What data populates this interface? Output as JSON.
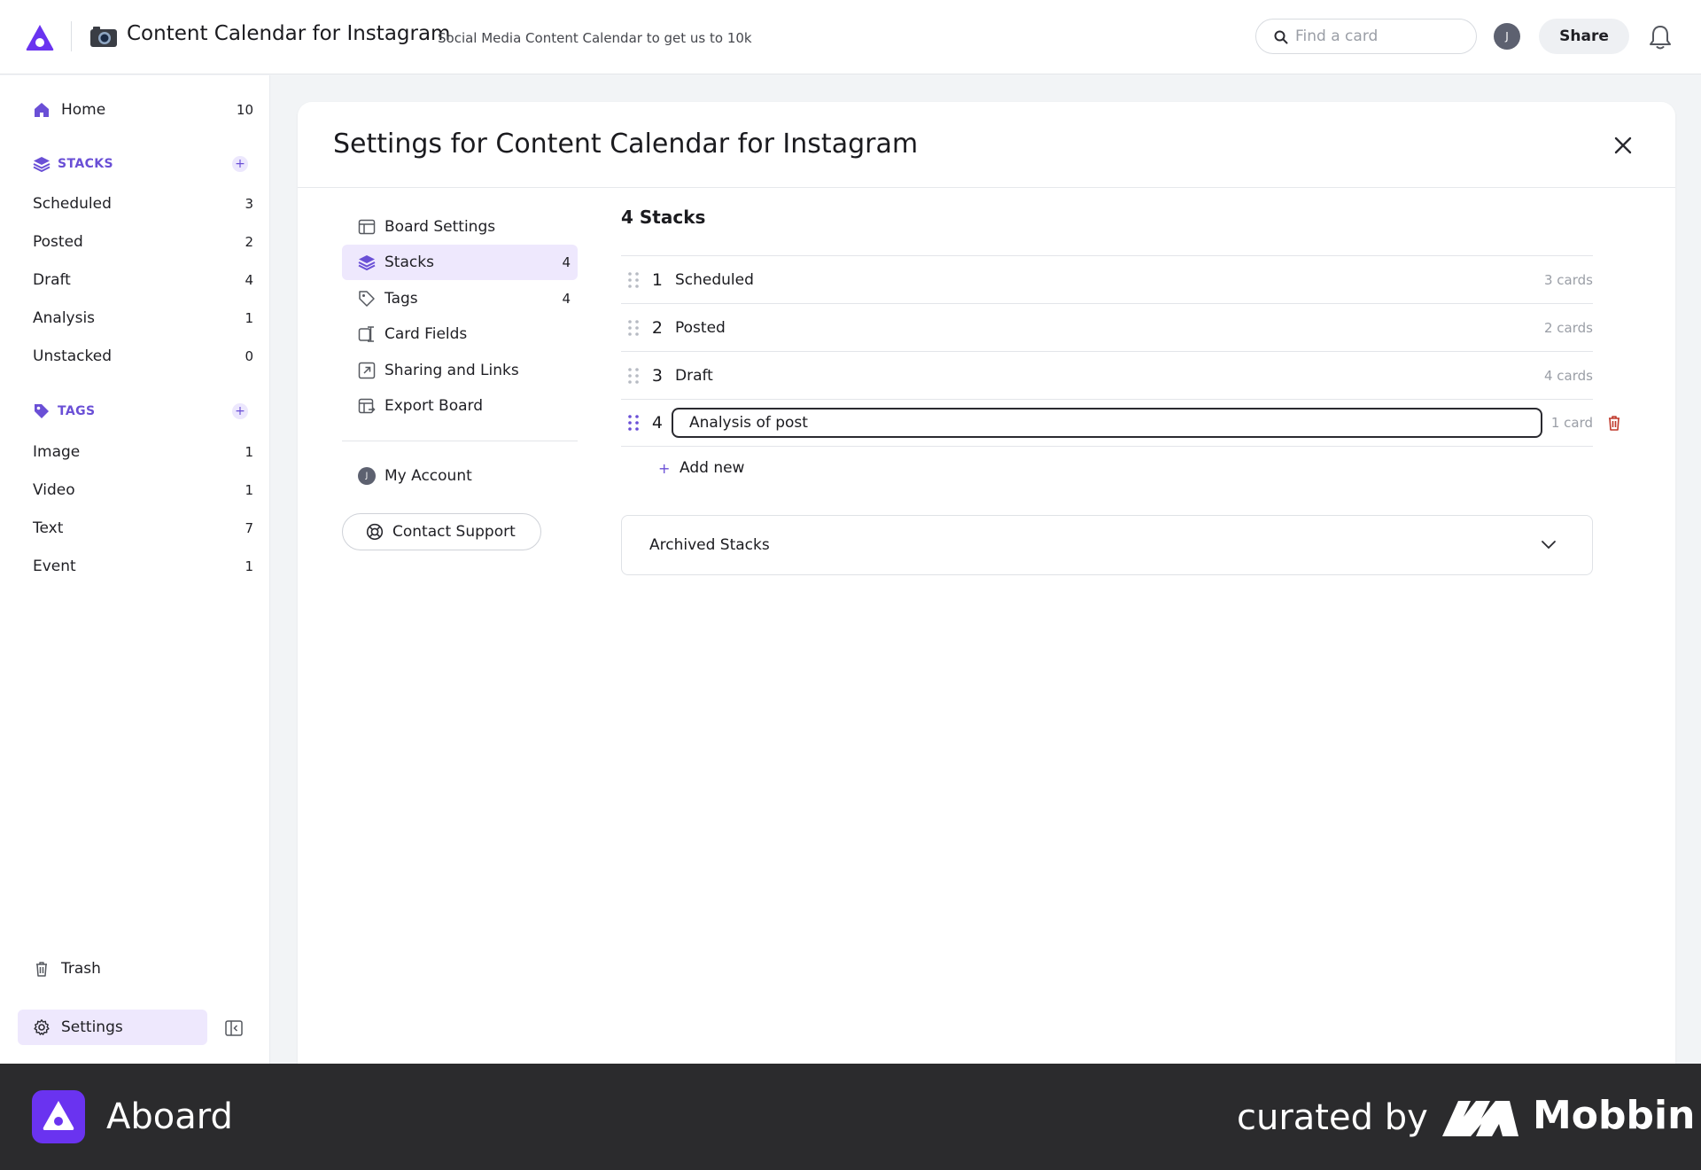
{
  "header": {
    "board_title": "Content Calendar for Instagram",
    "board_subtitle": "Social Media Content Calendar to get us to 10k",
    "search_placeholder": "Find a card",
    "avatar_initial": "J",
    "share_label": "Share"
  },
  "sidebar": {
    "home": {
      "label": "Home",
      "count": "10"
    },
    "stacks_heading": "STACKS",
    "stacks": [
      {
        "label": "Scheduled",
        "count": "3"
      },
      {
        "label": "Posted",
        "count": "2"
      },
      {
        "label": "Draft",
        "count": "4"
      },
      {
        "label": "Analysis",
        "count": "1"
      },
      {
        "label": "Unstacked",
        "count": "0"
      }
    ],
    "tags_heading": "TAGS",
    "tags": [
      {
        "label": "Image",
        "count": "1"
      },
      {
        "label": "Video",
        "count": "1"
      },
      {
        "label": "Text",
        "count": "7"
      },
      {
        "label": "Event",
        "count": "1"
      }
    ],
    "trash_label": "Trash",
    "settings_label": "Settings"
  },
  "modal": {
    "title": "Settings for Content Calendar for Instagram",
    "nav": [
      {
        "label": "Board Settings",
        "count": "",
        "icon": "board-icon"
      },
      {
        "label": "Stacks",
        "count": "4",
        "icon": "stacks-icon"
      },
      {
        "label": "Tags",
        "count": "4",
        "icon": "tag-icon"
      },
      {
        "label": "Card Fields",
        "count": "",
        "icon": "card-fields-icon"
      },
      {
        "label": "Sharing and Links",
        "count": "",
        "icon": "share-link-icon"
      },
      {
        "label": "Export Board",
        "count": "",
        "icon": "export-icon"
      }
    ],
    "account_label": "My Account",
    "account_initial": "J",
    "support_label": "Contact Support",
    "stacks_heading": "4 Stacks",
    "stacks": [
      {
        "num": "1",
        "name": "Scheduled",
        "cards": "3 cards"
      },
      {
        "num": "2",
        "name": "Posted",
        "cards": "2 cards"
      },
      {
        "num": "3",
        "name": "Draft",
        "cards": "4 cards"
      },
      {
        "num": "4",
        "name": "Analysis of post",
        "cards": "1 card"
      }
    ],
    "add_new_label": "Add new",
    "archived_label": "Archived Stacks"
  },
  "footer": {
    "brand": "Aboard",
    "curated": "curated by",
    "mobbin": "Mobbin"
  },
  "colors": {
    "accent": "#6a4fd6",
    "active_bg": "#eee8fd",
    "danger": "#c0392b",
    "footer_bg": "#2b2b2d"
  }
}
